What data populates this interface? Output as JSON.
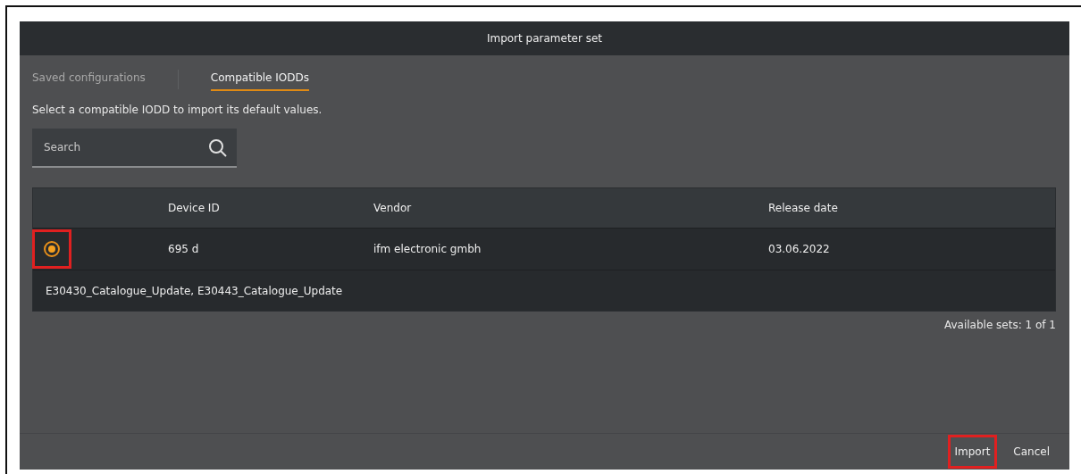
{
  "window": {
    "title": "Import parameter set"
  },
  "tabs": [
    {
      "label": "Saved configurations",
      "selected": false
    },
    {
      "label": "Compatible IODDs",
      "selected": true
    }
  ],
  "instruction": "Select a compatible IODD to import its default values.",
  "search": {
    "placeholder": "Search"
  },
  "table": {
    "columns": [
      "Device ID",
      "Vendor",
      "Release date"
    ],
    "rows": [
      {
        "selected": true,
        "highlighted": true,
        "cells": [
          "695 d",
          "ifm electronic gmbh",
          "03.06.2022"
        ],
        "detail": "E30430_Catalogue_Update, E30443_Catalogue_Update"
      }
    ]
  },
  "available": "Available sets: 1 of 1",
  "buttons": [
    {
      "label": "Import",
      "highlighted": true
    },
    {
      "label": "Cancel",
      "highlighted": false
    }
  ]
}
